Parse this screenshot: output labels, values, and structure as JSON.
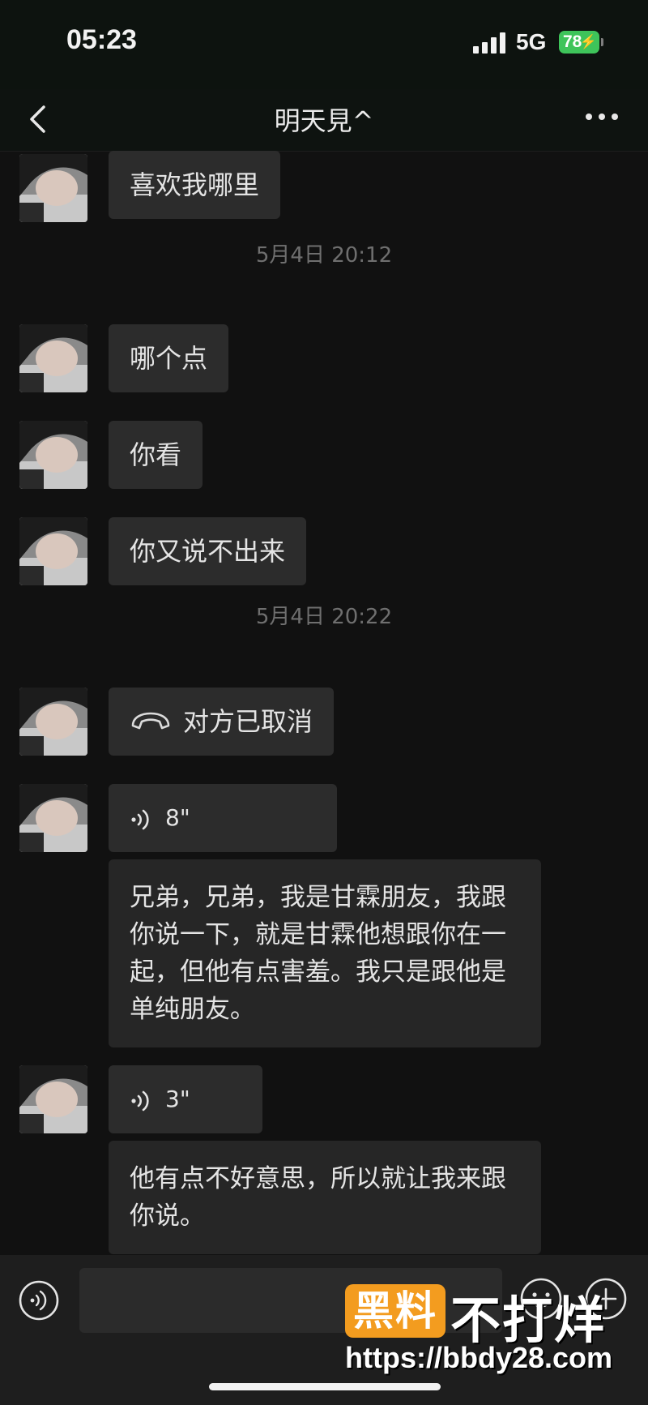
{
  "status_bar": {
    "time": "05:23",
    "network": "5G",
    "battery": "78"
  },
  "nav": {
    "title": "明天見^"
  },
  "messages": {
    "m1": "喜欢我哪里",
    "stamp1": "5月4日 20:12",
    "m2": "哪个点",
    "m3": "你看",
    "m4": "你又说不出来",
    "stamp2": "5月4日 20:22",
    "call": "对方已取消",
    "voice1_duration": "8\"",
    "voice1_transcript": "兄弟，兄弟，我是甘霖朋友，我跟你说一下，就是甘霖他想跟你在一起，但他有点害羞。我只是跟他是单纯朋友。",
    "voice2_duration": "3\"",
    "voice2_transcript": "他有点不好意思，所以就让我来跟你说。"
  },
  "watermark": {
    "logo": "黑料",
    "text": "不打烊",
    "url": "https://bbdy28.com"
  },
  "icons": [
    "back-chevron-icon",
    "more-dots-icon",
    "voice-wave-icon",
    "phone-hangup-icon",
    "voice-input-icon",
    "emoji-icon",
    "plus-icon"
  ]
}
